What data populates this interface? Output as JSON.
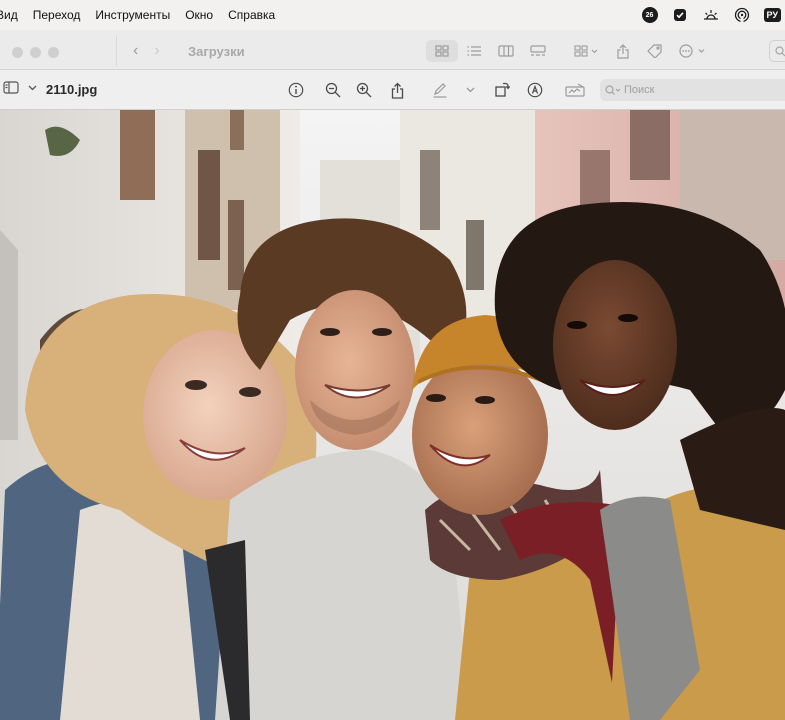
{
  "menubar": {
    "items": [
      "Вид",
      "Переход",
      "Инструменты",
      "Окно",
      "Справка"
    ],
    "status": {
      "calendar_badge": "26",
      "keyboard_layout": "РУ"
    }
  },
  "finder": {
    "title": "Загрузки",
    "nav_back": "‹",
    "nav_forward": "›"
  },
  "preview": {
    "filename": "2110.jpg",
    "search_placeholder": "Поиск"
  },
  "photo": {
    "subject": "photo",
    "colors": {
      "sky": "#ededee",
      "building_left": "#e5e1dc",
      "building_pink": "#dcb8b3",
      "jacket_denim": "#5b7188",
      "jacket_mustard": "#c99b4a",
      "backpack": "#7a1f25",
      "beanie": "#c6852a"
    }
  }
}
